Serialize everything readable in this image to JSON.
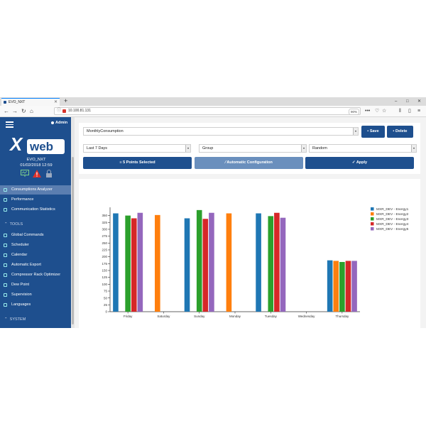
{
  "browser": {
    "tab_title": "EVO_NXT",
    "new_tab": "+",
    "url": "10.100.81.131",
    "zoom": "90%",
    "window_controls": [
      "–",
      "□",
      "✕"
    ]
  },
  "sidebar": {
    "user": "Admin",
    "logo_x": "X",
    "logo_web": "web",
    "device_name": "EVO_NXT",
    "device_datetime": "01/02/2018 12:59",
    "items": [
      {
        "label": "Consumptions Analyzer",
        "icon": "bar-chart-icon",
        "active": true
      },
      {
        "label": "Performance",
        "icon": "trend-icon"
      },
      {
        "label": "Communication Statistics",
        "icon": "signal-icon"
      }
    ],
    "tools_title": "TOOLS",
    "tools": [
      {
        "label": "Global Commands",
        "icon": "check-icon"
      },
      {
        "label": "Scheduler",
        "icon": "calendar-icon"
      },
      {
        "label": "Calendar",
        "icon": "calendar-icon"
      },
      {
        "label": "Automatic Export",
        "icon": "export-icon"
      },
      {
        "label": "Compressor Rack Optimizer",
        "icon": "wrench-icon"
      },
      {
        "label": "Dew Point",
        "icon": "droplet-icon"
      },
      {
        "label": "Supervision",
        "icon": "eye-icon"
      },
      {
        "label": "Languages",
        "icon": "flag-icon"
      }
    ],
    "system_title": "SYSTEM"
  },
  "controls": {
    "profile_select": "MonthlyConsumption",
    "save_label": "Save",
    "delete_label": "Delete",
    "period_select": "Last 7 Days",
    "group_select": "Group",
    "color_select": "Random",
    "points_button": "5 Points Selected",
    "auto_config_button": "Automatic Configuration",
    "apply_button": "Apply"
  },
  "colors": {
    "brand": "#1e4f8e",
    "series": [
      "#1f77b4",
      "#ff7f0e",
      "#2ca02c",
      "#d62728",
      "#9467bd"
    ]
  },
  "chart_data": {
    "type": "bar",
    "categories": [
      "Friday",
      "Saturday",
      "Sunday",
      "Monday",
      "Tuesday",
      "Wednesday",
      "Thursday"
    ],
    "series": [
      {
        "name": "MXR_DEV - Energy1",
        "values": [
          358,
          0,
          340,
          0,
          358,
          0,
          187
        ]
      },
      {
        "name": "MXR_DEV - Energy2",
        "values": [
          0,
          352,
          0,
          358,
          0,
          0,
          185
        ]
      },
      {
        "name": "MXR_DEV - Energy3",
        "values": [
          350,
          0,
          370,
          0,
          348,
          0,
          181
        ]
      },
      {
        "name": "MXR_DEV - Energy4",
        "values": [
          340,
          0,
          338,
          0,
          360,
          0,
          185
        ]
      },
      {
        "name": "MXR_DEV - Energy5",
        "values": [
          360,
          0,
          360,
          0,
          342,
          0,
          185
        ]
      }
    ],
    "yticks": [
      "0",
      "25",
      "50",
      "75",
      "100",
      "125",
      "150",
      "175",
      "200",
      "225",
      "250",
      "275",
      "300",
      "325",
      "350"
    ],
    "ylim": [
      0,
      380
    ],
    "legend": "right",
    "grid": false
  }
}
